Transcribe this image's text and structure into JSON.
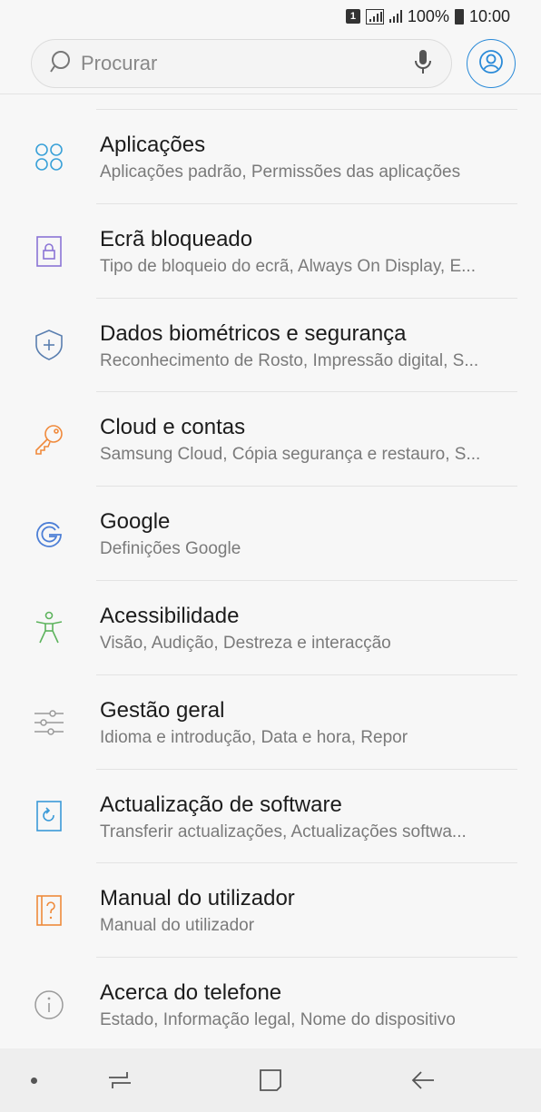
{
  "status_bar": {
    "sim": "1",
    "battery_text": "100%",
    "time": "10:00"
  },
  "search": {
    "placeholder": "Procurar"
  },
  "colors": {
    "accent": "#2a8ad8",
    "apps": "#3aa1d8",
    "lock": "#8b74d6",
    "biometrics": "#5a7fb0",
    "cloud": "#f08a3c",
    "google": "#4d7fd6",
    "accessibility": "#5db35d",
    "general": "#999999",
    "software": "#3a9ad8",
    "manual": "#ef8a3a",
    "about": "#9a9a9a"
  },
  "settings": {
    "items": [
      {
        "icon": "apps-grid-icon",
        "title": "Aplicações",
        "subtitle": "Aplicações padrão, Permissões das aplicações"
      },
      {
        "icon": "lock-screen-icon",
        "title": "Ecrã bloqueado",
        "subtitle": "Tipo de bloqueio do ecrã, Always On Display, E..."
      },
      {
        "icon": "shield-icon",
        "title": "Dados biométricos e segurança",
        "subtitle": "Reconhecimento de Rosto, Impressão digital, S..."
      },
      {
        "icon": "key-icon",
        "title": "Cloud e contas",
        "subtitle": "Samsung Cloud, Cópia segurança e restauro, S..."
      },
      {
        "icon": "google-icon",
        "title": "Google",
        "subtitle": "Definições Google"
      },
      {
        "icon": "accessibility-icon",
        "title": "Acessibilidade",
        "subtitle": "Visão, Audição, Destreza e interacção"
      },
      {
        "icon": "sliders-icon",
        "title": "Gestão geral",
        "subtitle": "Idioma e introdução, Data e hora, Repor"
      },
      {
        "icon": "software-update-icon",
        "title": "Actualização de software",
        "subtitle": "Transferir actualizações, Actualizações softwa..."
      },
      {
        "icon": "manual-icon",
        "title": "Manual do utilizador",
        "subtitle": "Manual do utilizador"
      },
      {
        "icon": "info-icon",
        "title": "Acerca do telefone",
        "subtitle": "Estado, Informação legal, Nome do dispositivo"
      }
    ]
  }
}
